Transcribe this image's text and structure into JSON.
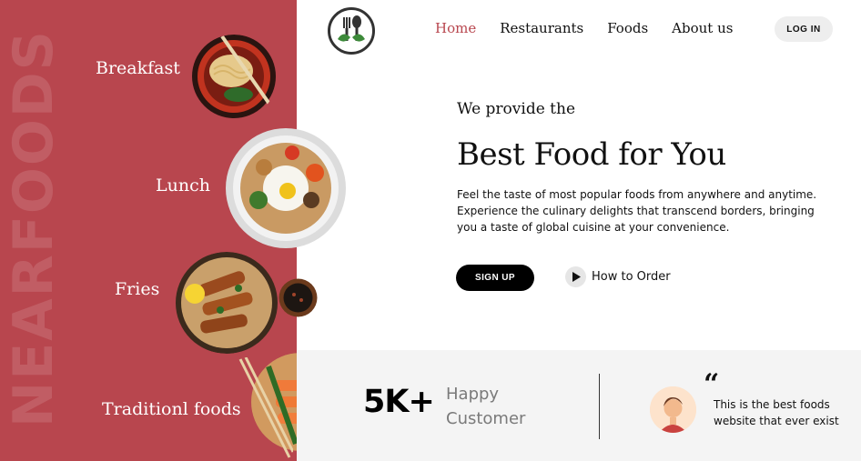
{
  "side": {
    "brand_vertical": "NEARFOODS",
    "categories": [
      {
        "label": "Breakfast"
      },
      {
        "label": "Lunch"
      },
      {
        "label": "Fries"
      },
      {
        "label": "Traditionl foods"
      }
    ]
  },
  "nav": {
    "items": [
      "Home",
      "Restaurants",
      "Foods",
      "About us"
    ],
    "active": "Home",
    "login_label": "LOG IN"
  },
  "hero": {
    "subtitle": "We provide the",
    "title": "Best Food for You",
    "description": "Feel the taste of most popular foods from anywhere and anytime. Experience the culinary delights that transcend borders, bringing you a taste of global cuisine at your convenience.",
    "signup_label": "SIGN UP",
    "how_to_label": "How to Order"
  },
  "stats": {
    "count": "5K+",
    "label": "Happy Customer"
  },
  "testimonial": {
    "quote_mark": "“",
    "text": "This is the best foods website that ever exist"
  },
  "colors": {
    "accent": "#b8464e",
    "band": "#f4f4f4",
    "button_dark": "#000000"
  }
}
